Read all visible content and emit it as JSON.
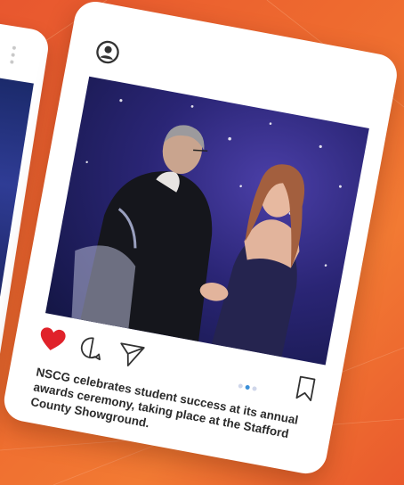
{
  "post": {
    "caption": "NSCG celebrates student success at its annual awards ceremony, taking place at the Stafford County Showground.",
    "liked": true,
    "carousel_count": 3,
    "carousel_active_index": 1
  },
  "icons": {
    "avatar": "user-circle-icon",
    "more": "vertical-dots-icon",
    "like": "heart-icon",
    "comment": "comment-bubble-icon",
    "share": "paper-plane-icon",
    "save": "bookmark-icon"
  },
  "colors": {
    "background": "#ee6a2f",
    "card": "#ffffff",
    "heart": "#e0222a",
    "caption_text": "#2b2b2b",
    "active_dot": "#3a8fd8"
  }
}
